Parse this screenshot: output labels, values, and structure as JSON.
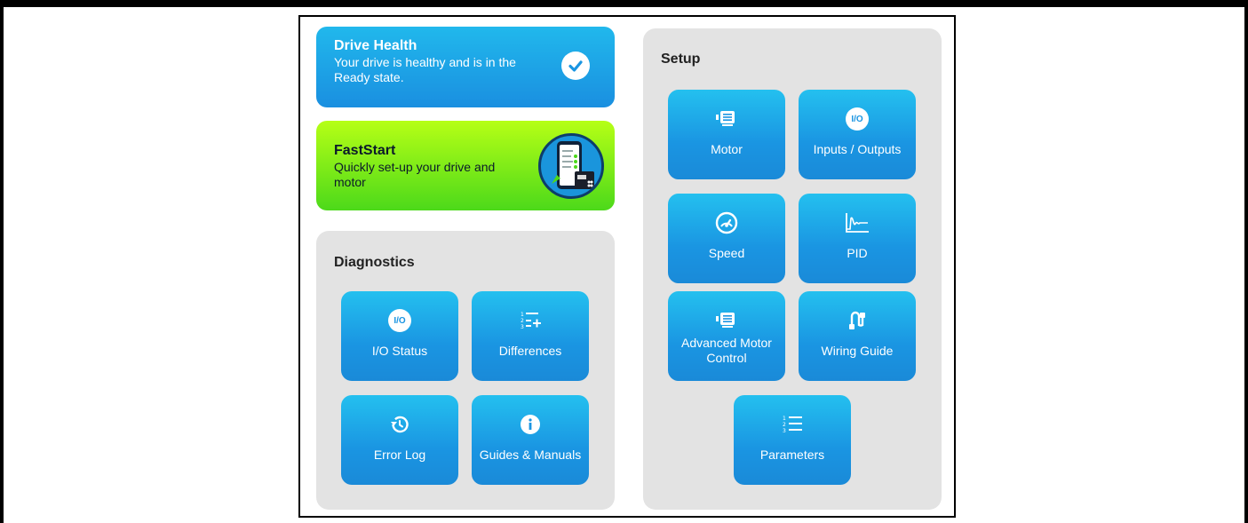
{
  "drive_health": {
    "title": "Drive Health",
    "description": "Your drive is healthy and is in the Ready state.",
    "status_icon": "check-circle-icon"
  },
  "fast_start": {
    "title": "FastStart",
    "description": "Quickly set-up your drive and motor",
    "illustration": "phone-drive-illustration"
  },
  "diagnostics": {
    "title": "Diagnostics",
    "tiles": [
      {
        "label": "I/O Status",
        "icon": "io-icon",
        "badge": "I/O"
      },
      {
        "label": "Differences",
        "icon": "list-add-icon"
      },
      {
        "label": "Error Log",
        "icon": "history-icon"
      },
      {
        "label": "Guides & Manuals",
        "icon": "info-icon"
      }
    ]
  },
  "setup": {
    "title": "Setup",
    "tiles": [
      {
        "label": "Motor",
        "icon": "motor-icon"
      },
      {
        "label": "Inputs / Outputs",
        "icon": "io-icon",
        "badge": "I/O"
      },
      {
        "label": "Speed",
        "icon": "speedometer-icon"
      },
      {
        "label": "PID",
        "icon": "pid-graph-icon"
      },
      {
        "label": "Advanced Motor Control",
        "icon": "motor-icon"
      },
      {
        "label": "Wiring Guide",
        "icon": "wiring-icon"
      },
      {
        "label": "Parameters",
        "icon": "numbered-list-icon"
      }
    ]
  },
  "colors": {
    "tile_blue": "#1a95e2",
    "fast_start_green": "#8bf01a",
    "panel_gray": "#e3e3e3"
  }
}
